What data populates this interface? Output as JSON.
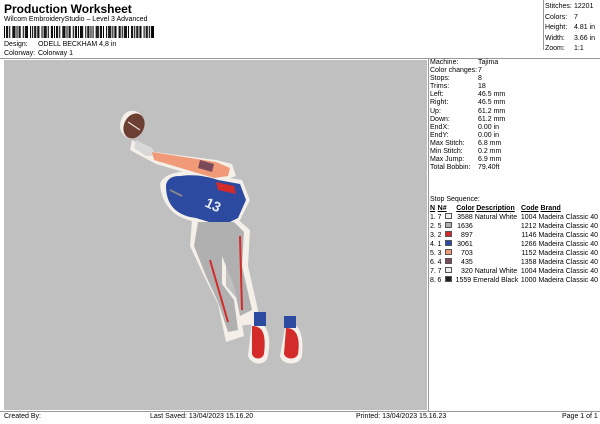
{
  "header": {
    "title": "Production Worksheet",
    "subtitle": "Wilcom EmbroideryStudio – Level 3 Advanced",
    "design_label": "Design:",
    "design_value": "ODELL BECKHAM 4,8 in",
    "colorway_label": "Colorway:",
    "colorway_value": "Colorway 1"
  },
  "stats": [
    {
      "label": "Stitches:",
      "value": "12201"
    },
    {
      "label": "Colors:",
      "value": "7"
    },
    {
      "label": "Height:",
      "value": "4.81 in"
    },
    {
      "label": "Width:",
      "value": "3.66 in"
    },
    {
      "label": "Zoom:",
      "value": "1:1"
    }
  ],
  "machine_info": [
    {
      "label": "Machine:",
      "value": "Tajima"
    },
    {
      "label": "Color changes:",
      "value": "7"
    },
    {
      "label": "Stops:",
      "value": "8"
    },
    {
      "label": "Trims:",
      "value": "18"
    },
    {
      "label": "Left:",
      "value": "46.5 mm"
    },
    {
      "label": "Right:",
      "value": "46.5 mm"
    },
    {
      "label": "Up:",
      "value": "61.2 mm"
    },
    {
      "label": "Down:",
      "value": "61.2 mm"
    },
    {
      "label": "EndX:",
      "value": "0.00 in"
    },
    {
      "label": "EndY:",
      "value": "0.00 in"
    },
    {
      "label": "Max Stitch:",
      "value": "6.8 mm"
    },
    {
      "label": "Min Stitch:",
      "value": "0.2 mm"
    },
    {
      "label": "Max Jump:",
      "value": "6.9 mm"
    },
    {
      "label": "Total Bobbin:",
      "value": "79.40ft"
    }
  ],
  "stop_sequence": {
    "title": "Stop Sequence:",
    "headers": {
      "n": "N",
      "no": "N#",
      "color": "Color",
      "description": "Description",
      "code": "Code",
      "brand": "Brand"
    },
    "rows": [
      {
        "n": "1.",
        "no": "7",
        "color_num": "3588",
        "swatch": "#eeeeee",
        "description": "Natural White",
        "code": "1004",
        "brand": "Madeira Classic 40"
      },
      {
        "n": "2.",
        "no": "5",
        "color_num": "1636",
        "swatch": "#b0b0b0",
        "description": "",
        "code": "1212",
        "brand": "Madeira Classic 40"
      },
      {
        "n": "3.",
        "no": "2",
        "color_num": "897",
        "swatch": "#d32a2a",
        "description": "",
        "code": "1146",
        "brand": "Madeira Classic 40"
      },
      {
        "n": "4.",
        "no": "1",
        "color_num": "3061",
        "swatch": "#2b4aa0",
        "description": "",
        "code": "1266",
        "brand": "Madeira Classic 40"
      },
      {
        "n": "5.",
        "no": "3",
        "color_num": "703",
        "swatch": "#f09a78",
        "description": "",
        "code": "1152",
        "brand": "Madeira Classic 40"
      },
      {
        "n": "6.",
        "no": "4",
        "color_num": "435",
        "swatch": "#7a4a5a",
        "description": "",
        "code": "1358",
        "brand": "Madeira Classic 40"
      },
      {
        "n": "7.",
        "no": "7",
        "color_num": "320",
        "swatch": "#eeeeee",
        "description": "Natural White",
        "code": "1004",
        "brand": "Madeira Classic 40"
      },
      {
        "n": "8.",
        "no": "6",
        "color_num": "1559",
        "swatch": "#222222",
        "description": "Emerald Black",
        "code": "1000",
        "brand": "Madeira Classic 40"
      }
    ]
  },
  "footer": {
    "created_by": "Created By:",
    "last_saved": "Last Saved: 13/04/2023 15.16.20",
    "printed": "Printed: 13/04/2023 15.16.23",
    "page": "Page 1 of 1"
  },
  "canvas_background": "#c0c0c0"
}
